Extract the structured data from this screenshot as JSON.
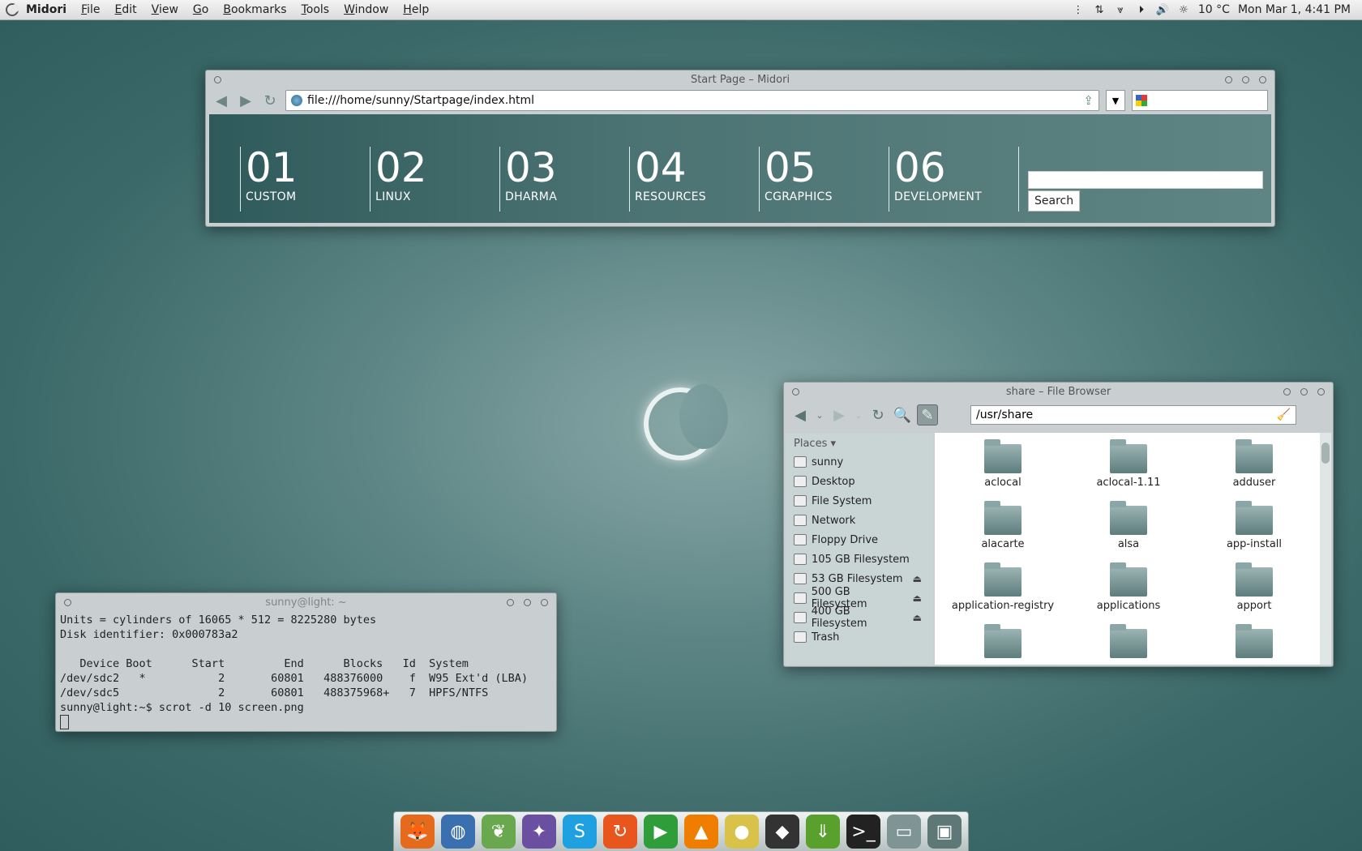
{
  "top_panel": {
    "app_name": "Midori",
    "menus": [
      "File",
      "Edit",
      "View",
      "Go",
      "Bookmarks",
      "Tools",
      "Window",
      "Help"
    ],
    "temperature": "10 °C",
    "clock": "Mon Mar  1,  4:41 PM",
    "tray_icons": [
      "menu-icon",
      "network-transfer-icon",
      "download-icon",
      "play-icon",
      "volume-icon",
      "weather-icon"
    ]
  },
  "browser": {
    "title": "Start Page – Midori",
    "url": "file:///home/sunny/Startpage/index.html",
    "categories": [
      {
        "num": "01",
        "label": "CUSTOM"
      },
      {
        "num": "02",
        "label": "LINUX"
      },
      {
        "num": "03",
        "label": "DHARMA"
      },
      {
        "num": "04",
        "label": "RESOURCES"
      },
      {
        "num": "05",
        "label": "CGRAPHICS"
      },
      {
        "num": "06",
        "label": "DEVELOPMENT"
      }
    ],
    "search_button": "Search"
  },
  "file_browser": {
    "title": "share – File Browser",
    "path": "/usr/share",
    "places_header": "Places",
    "places": [
      {
        "label": "sunny",
        "eject": false
      },
      {
        "label": "Desktop",
        "eject": false
      },
      {
        "label": "File System",
        "eject": false
      },
      {
        "label": "Network",
        "eject": false
      },
      {
        "label": "Floppy Drive",
        "eject": false
      },
      {
        "label": "105 GB Filesystem",
        "eject": false
      },
      {
        "label": "53 GB Filesystem",
        "eject": true
      },
      {
        "label": "500 GB Filesystem",
        "eject": true
      },
      {
        "label": "400 GB Filesystem",
        "eject": true
      },
      {
        "label": "Trash",
        "eject": false
      }
    ],
    "files": [
      "aclocal",
      "aclocal-1.11",
      "adduser",
      "alacarte",
      "alsa",
      "app-install",
      "application-registry",
      "applications",
      "apport",
      "",
      "",
      ""
    ]
  },
  "terminal": {
    "title": "sunny@light: ~",
    "lines": [
      "Units = cylinders of 16065 * 512 = 8225280 bytes",
      "Disk identifier: 0x000783a2",
      "",
      "   Device Boot      Start         End      Blocks   Id  System",
      "/dev/sdc2   *           2       60801   488376000    f  W95 Ext'd (LBA)",
      "/dev/sdc5               2       60801   488375968+   7  HPFS/NTFS",
      "sunny@light:~$ scrot -d 10 screen.png"
    ]
  },
  "dock": {
    "apps": [
      {
        "name": "firefox-icon",
        "color": "#e56a1b",
        "glyph": "🦊"
      },
      {
        "name": "earth-icon",
        "color": "#3a6fb0",
        "glyph": "◍"
      },
      {
        "name": "midori-icon",
        "color": "#6aa84f",
        "glyph": "❦"
      },
      {
        "name": "pidgin-icon",
        "color": "#6b4fa0",
        "glyph": "✦"
      },
      {
        "name": "skype-icon",
        "color": "#1fa0e0",
        "glyph": "S"
      },
      {
        "name": "refresh-app-icon",
        "color": "#e8561e",
        "glyph": "↻"
      },
      {
        "name": "media-player-icon",
        "color": "#2e9d3a",
        "glyph": "▶"
      },
      {
        "name": "vlc-icon",
        "color": "#ef7d00",
        "glyph": "▲"
      },
      {
        "name": "panda-icon",
        "color": "#d9c24a",
        "glyph": "●"
      },
      {
        "name": "inkscape-icon",
        "color": "#333333",
        "glyph": "◆"
      },
      {
        "name": "download-manager-icon",
        "color": "#5aa02c",
        "glyph": "⇓"
      },
      {
        "name": "terminal-icon",
        "color": "#222222",
        "glyph": ">_"
      },
      {
        "name": "file-manager-icon",
        "color": "#7f9494",
        "glyph": "▭"
      },
      {
        "name": "system-icon",
        "color": "#5e7777",
        "glyph": "▣"
      }
    ]
  }
}
